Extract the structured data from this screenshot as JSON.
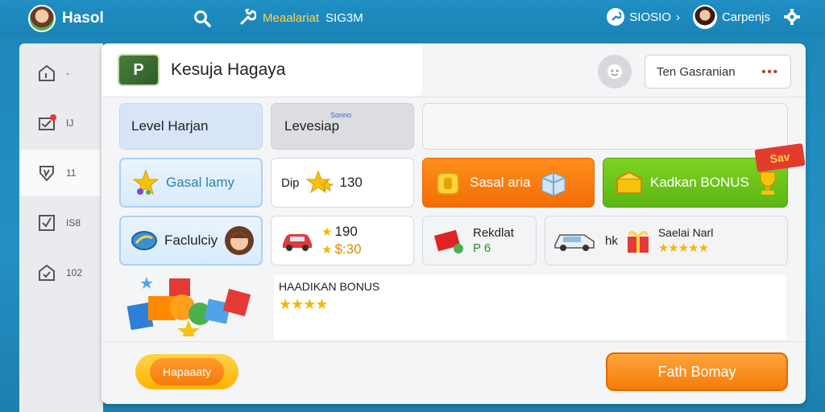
{
  "topbar": {
    "brand": "Hasol",
    "promo_highlight": "Meaalariat",
    "promo_text": "SIG3M",
    "balance": "SIOSIO",
    "user_name": "Carpenjs"
  },
  "sidebar": {
    "items": [
      {
        "label": "-",
        "icon": "home-icon"
      },
      {
        "label": "IJ",
        "icon": "mail-icon"
      },
      {
        "label": "11",
        "icon": "shield-icon"
      },
      {
        "label": "IS8",
        "icon": "check-box-icon"
      },
      {
        "label": "102",
        "icon": "home-check-icon"
      }
    ]
  },
  "header": {
    "logo_text": "P",
    "title": "Kesuja Hagaya",
    "select_value": "Ten Gasranian",
    "select_more": "•••"
  },
  "tiles": {
    "r1": [
      {
        "label": "Level Harjan"
      },
      {
        "label": "Levesiap",
        "sub": "Sonno"
      },
      {
        "label": ""
      }
    ],
    "r2": [
      {
        "label": "Gasal lamy"
      },
      {
        "label": "Dip",
        "value": "130"
      },
      {
        "label": "Sasal aria"
      },
      {
        "label": "Kadkan BONUS"
      }
    ],
    "r2_badge": "Sav",
    "r3": [
      {
        "label": "Faclulciy"
      },
      {
        "value": "190",
        "price": "$:30"
      },
      {
        "label": "Rekdlat",
        "sub": "P 6"
      },
      {
        "label": "hk",
        "title": "Saelai Narl",
        "rating": "★★★★★"
      }
    ]
  },
  "bonus": {
    "title": "HAADIKAN BONUS",
    "rating": "★★★★"
  },
  "buttons": {
    "left": "Hapaaaty",
    "right": "Fath Bomay"
  },
  "colors": {
    "primary_blue": "#1f8fc4",
    "orange": "#f57c0a",
    "green": "#5cb514"
  }
}
